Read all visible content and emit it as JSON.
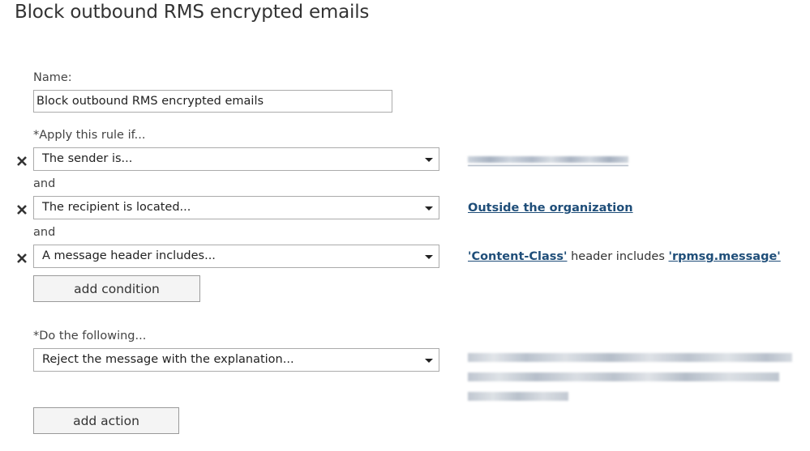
{
  "page": {
    "title": "Block outbound RMS encrypted emails"
  },
  "name_section": {
    "label": "Name:",
    "value": "Block outbound RMS encrypted emails"
  },
  "conditions_section": {
    "label": "*Apply this rule if...",
    "joiner": "and",
    "conditions": [
      {
        "dropdown_value": "The sender is...",
        "detail_blurred": true
      },
      {
        "dropdown_value": "The recipient is located...",
        "detail_link": "Outside the organization"
      },
      {
        "dropdown_value": "A message header includes...",
        "detail_link_1": "'Content-Class'",
        "detail_text": " header includes ",
        "detail_link_2": "'rpmsg.message'"
      }
    ],
    "add_button": "add condition"
  },
  "actions_section": {
    "label": "*Do the following...",
    "action_dropdown_value": "Reject the message with the explanation...",
    "detail_blurred": true,
    "add_button": "add action"
  },
  "icons": {
    "remove": "close-x-icon",
    "dropdown": "chevron-down-icon"
  },
  "colors": {
    "link": "#1f4e79",
    "border": "#ababab",
    "button_bg": "#f4f4f4"
  }
}
